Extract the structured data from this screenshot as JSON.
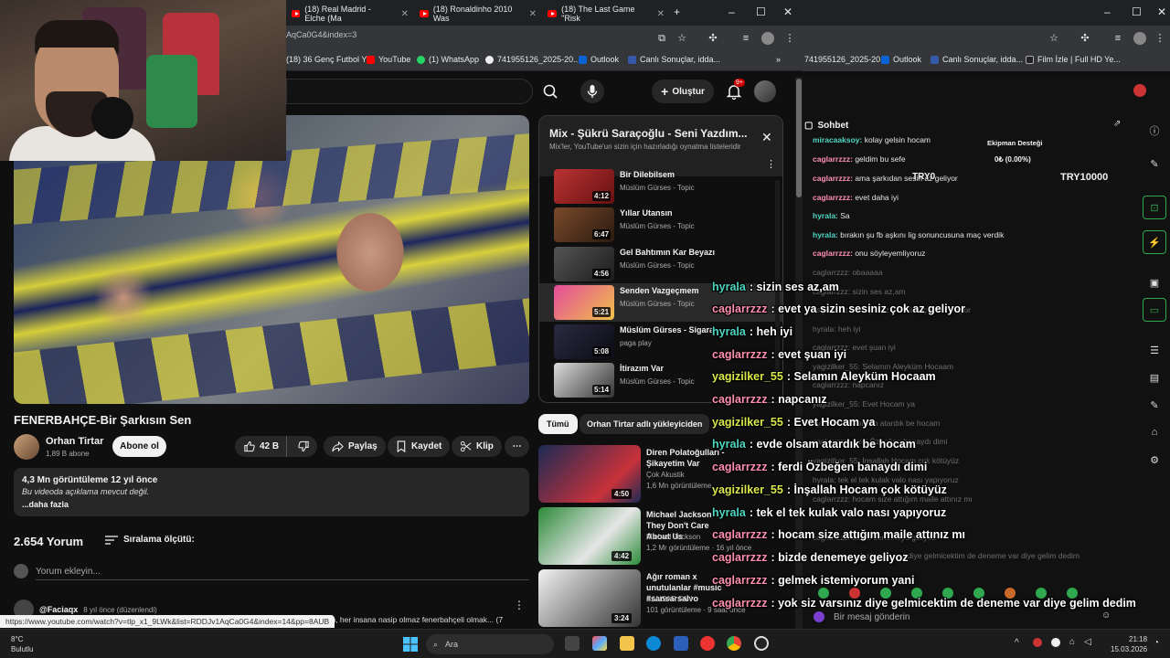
{
  "browser": {
    "tabs": [
      {
        "title": "(18) Real Madrid - Elche (Ma"
      },
      {
        "title": "(18) Ronaldinho 2010 Was"
      },
      {
        "title": "(18) The Last Game \"Risk"
      }
    ],
    "url": "AqCa0G4&index=3",
    "bookmarks": [
      {
        "label": "(18) 36 Genç Futbol Y..."
      },
      {
        "label": "YouTube"
      },
      {
        "label": "(1) WhatsApp"
      },
      {
        "label": "741955126_2025-20..."
      },
      {
        "label": "Outlook"
      },
      {
        "label": "Canlı Sonuçlar, idda..."
      }
    ],
    "bookmarks_right": [
      {
        "label": "741955126_2025-20..."
      },
      {
        "label": "Outlook"
      },
      {
        "label": "Canlı Sonuçlar, idda..."
      },
      {
        "label": "Film İzle | Full HD Ye..."
      }
    ]
  },
  "youtube": {
    "create_label": "Oluştur",
    "notif_badge": "9+",
    "video": {
      "title": "FENERBAHÇE-Bir Şarkısın Sen",
      "channel": "Orhan Tirtar",
      "subs": "1,89 B abone",
      "subscribe": "Abone ol",
      "likes": "42 B",
      "share": "Paylaş",
      "save": "Kaydet",
      "clip": "Klip",
      "stats": "4,3 Mn görüntüleme  12 yıl önce",
      "description": "Bu videoda açıklama mevcut değil.",
      "more": "...daha fazla"
    },
    "comments": {
      "count": "2.654 Yorum",
      "sort": "Sıralama ölçütü:",
      "add_placeholder": "Yorum ekleyin...",
      "first_author": "@Faciaqx",
      "first_meta": "8 yıl önce (düzenlendi)",
      "first_text": "yeyim, her insana nasip olmaz fenerbahçeli olmak... (7"
    },
    "playlist": {
      "title": "Mix - Şükrü Saraçoğlu - Seni Yazdım...",
      "subtitle": "Mix'ler, YouTube'un sizin için hazırladığı oynatma listeleridir",
      "items": [
        {
          "title": "Bir Dilebilsem",
          "artist": "Müslüm Gürses - Topic",
          "duration": "4:12"
        },
        {
          "title": "Yıllar Utansın",
          "artist": "Müslüm Gürses - Topic",
          "duration": "6:47"
        },
        {
          "title": "Gel Bahtımın Kar Beyazı",
          "artist": "Müslüm Gürses - Topic",
          "duration": "4:56"
        },
        {
          "title": "Senden Vazgeçmem",
          "artist": "Müslüm Gürses - Topic",
          "duration": "5:21"
        },
        {
          "title": "Müslüm Gürses - Sigara",
          "artist": "paga play",
          "duration": "5:08"
        },
        {
          "title": "İtirazım Var",
          "artist": "Müslüm Gürses - Topic",
          "duration": "5:14"
        }
      ]
    },
    "chips": {
      "all": "Tümü",
      "channel": "Orhan Tirtar adlı yükleyiciden"
    },
    "recommendations": [
      {
        "title": "Diren Polatoğulları - Şikayetim Var",
        "channel": "Çok Akustik",
        "views": "1,6 Mn görüntüleme",
        "duration": "4:50"
      },
      {
        "title": "Michael Jackson - They Don't Care About Us",
        "channel": "Michael Jackson",
        "views": "1,2 Mr görüntüleme · 16 yıl önce",
        "duration": "4:42"
      },
      {
        "title": "Ağır roman x unutulanlar #music #sansarsalvo",
        "channel": "SANSAR FAN",
        "views": "101 görüntüleme · 9 saat önce",
        "duration": "3:24"
      }
    ]
  },
  "chat": {
    "header": "Sohbet",
    "small_messages": [
      {
        "user": "miracaaksoy:",
        "text": "kolay gelsin hocam"
      },
      {
        "user": "caglarrzzz:",
        "text": "geldim bu sefe"
      },
      {
        "user": "caglarrzzz:",
        "text": "ama şarkıdan sesin az geliyor"
      },
      {
        "user": "caglarrzzz:",
        "text": "evet daha iyi"
      },
      {
        "user": "hyrala:",
        "text": "Sa"
      },
      {
        "user": "hyrala:",
        "text": "bırakın şu fb aşkını lig sonuncusuna maç verdik"
      },
      {
        "user": "caglarrzzz:",
        "text": "onu söyleyemliyoruz"
      }
    ],
    "faded_messages": [
      "caglarrzzz: obaaaaa",
      "caglarrzzz: sizin ses az,am",
      "caglarrzzz: evet ya sizin sesiniz çok az geliyor",
      "hyrala: heh iyi",
      "caglarrzzz: evet şuan iyi",
      "yagizilker_55: Selamın Aleyküm Hocaam",
      "caglarrzzz: napcanız",
      "yagizilker_55: Evet Hocam ya",
      "hyrala: evde olsam atardık be hocam",
      "caglarrzzz: ferdi Özbeğen banaydı dimi",
      "yagizilker_55: İnşallah Hocam çok kötüyüz",
      "hyrala: tek el tek kulak valo nası yapıyoruz",
      "caglarrzzz: hocam size attığım maile attınız mı",
      "caglarrzzz: bizde denemeye geliyoz",
      "caglarrzzz: yok siz varsınız diye gelmicektim de deneme var diye gelim dedim"
    ],
    "overlay": [
      {
        "user": "hyrala",
        "text": ": sizin ses az,am",
        "color": "#4fd6c2"
      },
      {
        "user": "caglarrzzz",
        "text": ": evet ya sizin sesiniz çok az geliyor",
        "color": "#ff8fb0"
      },
      {
        "user": "hyrala",
        "text": ": heh iyi",
        "color": "#4fd6c2"
      },
      {
        "user": "caglarrzzz",
        "text": ": evet şuan iyi",
        "color": "#ff8fb0"
      },
      {
        "user": "yagizilker_55",
        "text": ": Selamın Aleyküm Hocaam",
        "color": "#d9e84a"
      },
      {
        "user": "caglarrzzz",
        "text": ": napcanız",
        "color": "#ff8fb0"
      },
      {
        "user": "yagizilker_55",
        "text": ": Evet Hocam ya",
        "color": "#d9e84a"
      },
      {
        "user": "hyrala",
        "text": ": evde olsam atardık be hocam",
        "color": "#4fd6c2"
      },
      {
        "user": "caglarrzzz",
        "text": ": ferdi Özbeğen banaydı dimi",
        "color": "#ff8fb0"
      },
      {
        "user": "yagizilker_55",
        "text": ": İnşallah Hocam çok kötüyüz",
        "color": "#d9e84a"
      },
      {
        "user": "hyrala",
        "text": ": tek el tek kulak valo nası yapıyoruz",
        "color": "#4fd6c2"
      },
      {
        "user": "caglarrzzz",
        "text": ": hocam size attığım maile attınız mı",
        "color": "#ff8fb0"
      },
      {
        "user": "caglarrzzz",
        "text": ": bizde denemeye geliyoz",
        "color": "#ff8fb0"
      },
      {
        "user": "caglarrzzz",
        "text": ": gelmek istemiyorum yani",
        "color": "#ff8fb0"
      },
      {
        "user": "caglarrzzz",
        "text": ": yok siz varsınız diye gelmicektim de deneme var diye gelim dedim",
        "color": "#ff8fb0"
      }
    ],
    "ekipman": "Ekipman Desteği",
    "ekipman_value": "0₺ (0.00%)",
    "try_small": "TRY0",
    "try_big": "TRY10000",
    "input_placeholder": "Bir mesaj gönderin"
  },
  "status_url": "https://www.youtube.com/watch?v=tlp_x1_9LWk&list=RDDJv1AqCa0G4&index=14&pp=8AUB",
  "taskbar": {
    "weather_temp": "8°C",
    "weather_desc": "Bulutlu",
    "search": "Ara",
    "time": "21:18",
    "date": "15.03.2026"
  },
  "colors": {
    "accent_red": "#ff0000",
    "chat_teal": "#4fd6c2",
    "chat_pink": "#ff8fb0",
    "chat_yellow": "#d9e84a"
  }
}
